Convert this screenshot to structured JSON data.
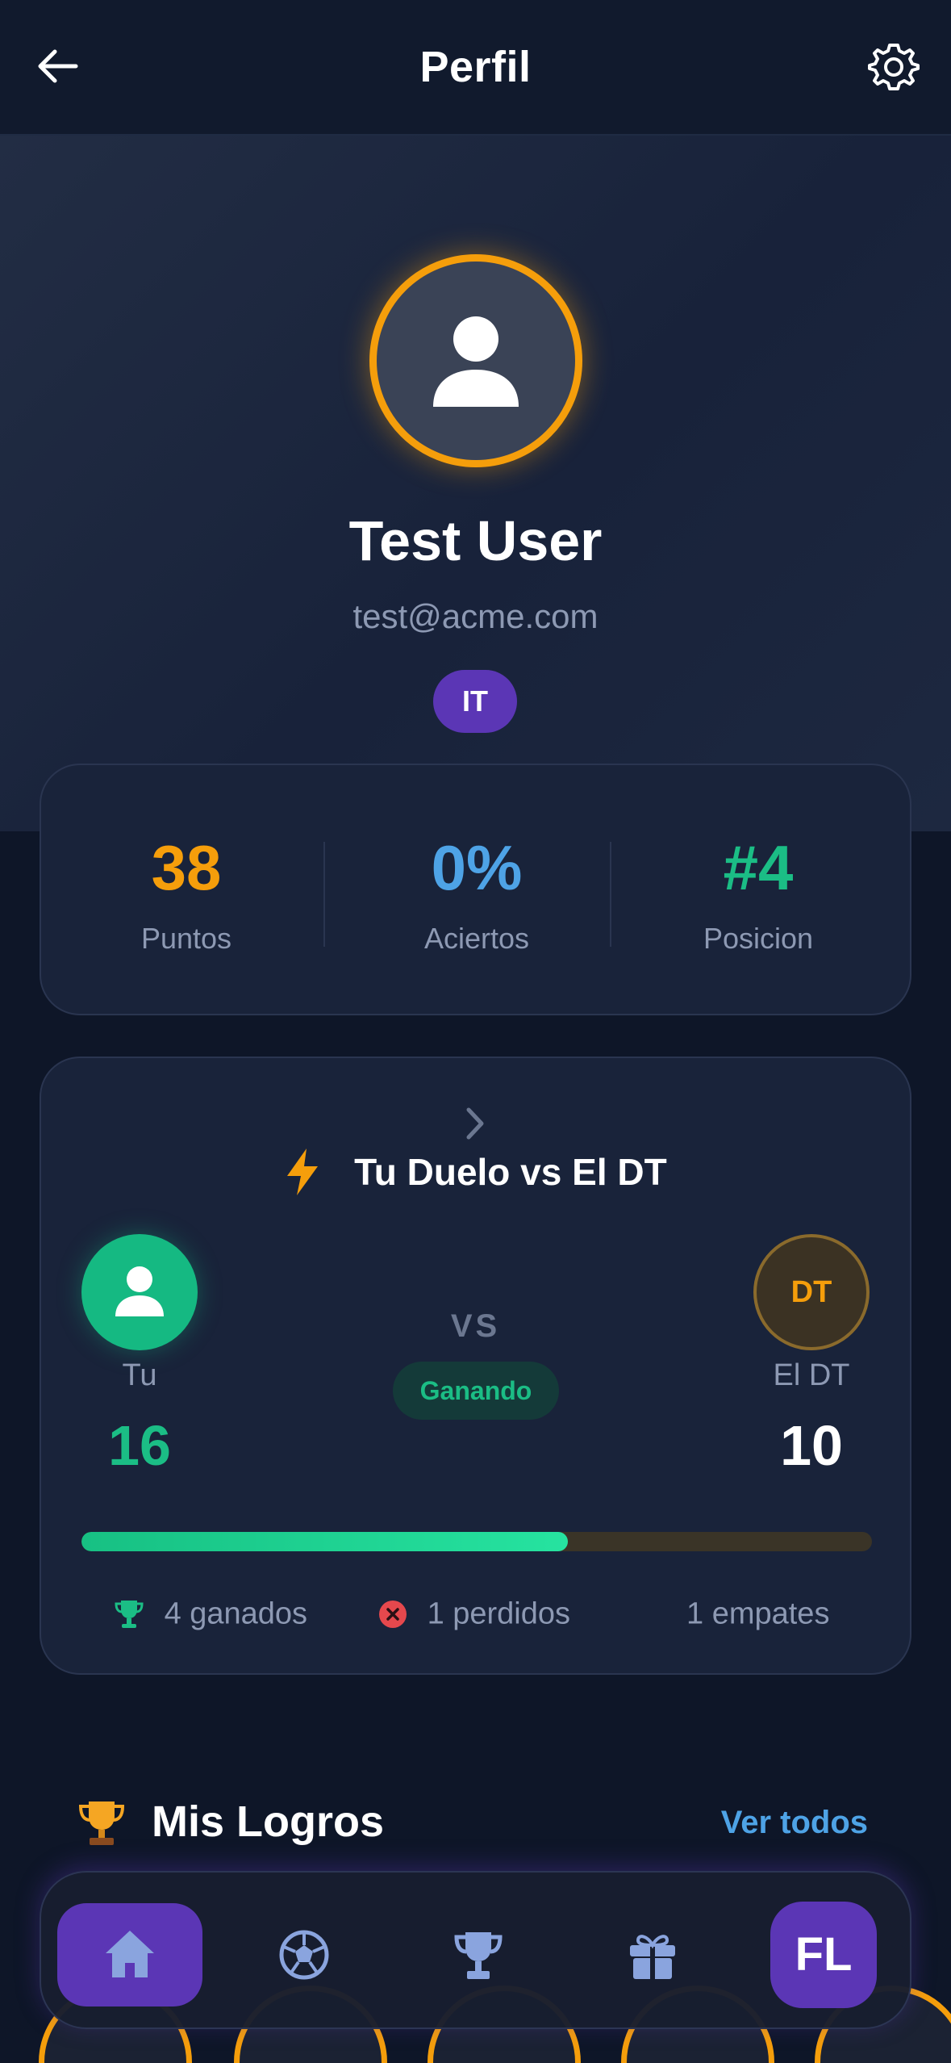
{
  "header": {
    "title": "Perfil",
    "back_icon": "arrow-left-icon",
    "settings_icon": "gear-icon"
  },
  "profile": {
    "name": "Test User",
    "email": "test@acme.com",
    "initials_badge": "IT",
    "avatar_icon": "user-icon",
    "ring_color": "#f59e0b"
  },
  "stats": [
    {
      "value": "38",
      "label": "Puntos",
      "color": "#f59e0b"
    },
    {
      "value": "0%",
      "label": "Aciertos",
      "color": "#4ea3e6"
    },
    {
      "value": "#4",
      "label": "Posicion",
      "color": "#1bbd85"
    }
  ],
  "duel": {
    "title": "Tu Duelo vs El DT",
    "title_icon": "bolt-icon",
    "vs_label": "VS",
    "status": "Ganando",
    "you": {
      "name": "Tu",
      "score": "16",
      "color": "#15b982"
    },
    "opponent": {
      "name": "El DT",
      "initials": "DT",
      "score": "10"
    },
    "progress": 0.615,
    "results": {
      "won": "4 ganados",
      "lost": "1 perdidos",
      "draws": "1 empates"
    }
  },
  "achievements": {
    "title": "Mis Logros",
    "view_all": "Ver todos"
  },
  "nav": {
    "items": [
      "home-icon",
      "soccer-ball-icon",
      "trophy-icon",
      "gift-icon"
    ],
    "active": "home-icon",
    "profile_initials": "FL"
  },
  "colors": {
    "accent_purple": "#5b36b5",
    "background": "#0e1628",
    "card": "#19233a"
  }
}
